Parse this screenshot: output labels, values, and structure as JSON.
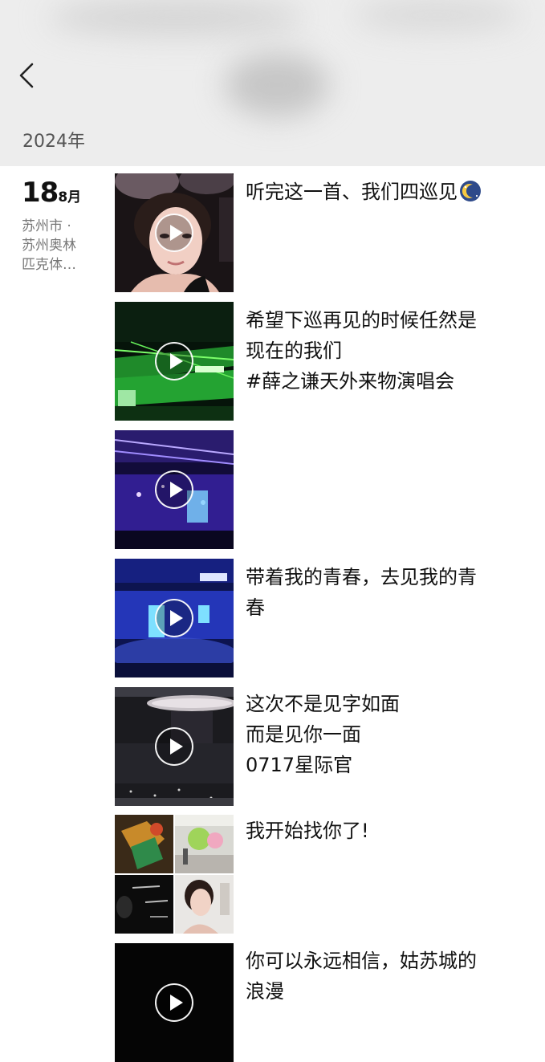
{
  "header": {
    "year": "2024年"
  },
  "date": {
    "day": "18",
    "month": "8月",
    "location_lines": [
      "苏州市 ·",
      "苏州奥林",
      "匹克体…"
    ]
  },
  "posts": [
    {
      "type": "video",
      "caption_lines": [
        "听完这一首、我们四巡见"
      ],
      "emoji_name": "moon-emoji-icon"
    },
    {
      "type": "video",
      "caption_lines": [
        "希望下巡再见的时候任然是",
        "现在的我们",
        "#薛之谦天外来物演唱会"
      ]
    },
    {
      "type": "video",
      "caption_lines": []
    },
    {
      "type": "video",
      "caption_lines": [
        "带着我的青春，去见我的青",
        "春"
      ]
    },
    {
      "type": "video",
      "caption_lines": [
        "这次不是见字如面",
        "而是见你一面",
        "0717星际官"
      ]
    },
    {
      "type": "photos",
      "caption_lines": [
        "我开始找你了!"
      ],
      "photo_count": 4
    },
    {
      "type": "video",
      "caption_lines": [
        "你可以永远相信，姑苏城的",
        "浪漫"
      ]
    }
  ],
  "colors": {
    "header_bg": "#ededed",
    "muted_text": "#777777"
  }
}
